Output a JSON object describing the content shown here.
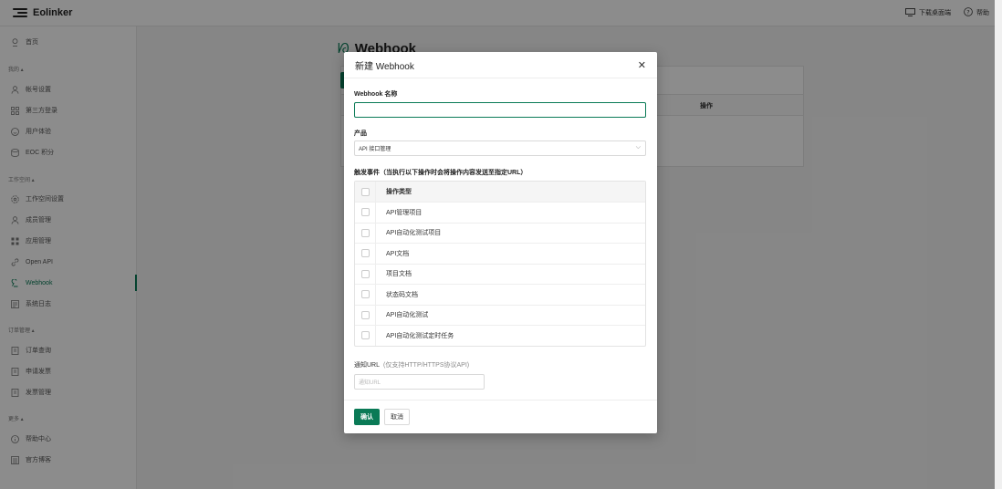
{
  "app": {
    "logo_text": "Eolinker"
  },
  "topbar": {
    "download_label": "下载桌面端",
    "help_label": "帮助"
  },
  "sidebar": {
    "home": "首页",
    "group_mine": "我的 ▴",
    "account": "帐号设置",
    "third_party": "第三方登录",
    "user_exp": "用户体验",
    "eoc_points": "EOC 积分",
    "group_workspace": "工作空间 ▴",
    "workspace_settings": "工作空间设置",
    "members": "成员管理",
    "apps": "应用管理",
    "open_api": "Open API",
    "webhook": "Webhook",
    "system_log": "系统日志",
    "group_orders": "订单管理 ▴",
    "order_query": "订单查询",
    "apply_invoice": "申请发票",
    "invoice_mgmt": "发票管理",
    "group_more": "更多 ▴",
    "help_center": "帮助中心",
    "blog": "官方博客"
  },
  "main": {
    "page_title": "Webhook",
    "table_op_header": "操作"
  },
  "modal": {
    "title": "新建 Webhook",
    "name_label": "Webhook 名称",
    "name_value": "",
    "product_label": "产品",
    "product_value": "API 接口管理",
    "events_label": "触发事件（当执行以下操作时会将操作内容发送至指定URL）",
    "events_header": "操作类型",
    "events": [
      "API管理项目",
      "API自动化测试项目",
      "API文档",
      "项目文档",
      "状态码文档",
      "API自动化测试",
      "API自动化测试定时任务"
    ],
    "url_label": "通知URL",
    "url_hint": "(仅支持HTTP/HTTPS协议API)",
    "url_placeholder": "通知URL",
    "ok_label": "确认",
    "cancel_label": "取消"
  },
  "colors": {
    "accent": "#0a7a56"
  }
}
